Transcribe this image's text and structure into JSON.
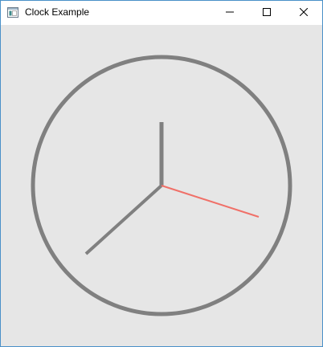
{
  "window": {
    "title": "Clock Example",
    "icon": "app-window-icon",
    "controls": {
      "minimize_icon": "minimize-icon",
      "maximize_icon": "maximize-icon",
      "close_icon": "close-icon"
    }
  },
  "clock": {
    "face_color": "#808080",
    "hand_color": "#808080",
    "second_hand_color": "#f07068",
    "background_color": "#e6e6e6",
    "hour_hand_icon": "hour-hand",
    "minute_hand_icon": "minute-hand",
    "second_hand_icon": "second-hand"
  }
}
